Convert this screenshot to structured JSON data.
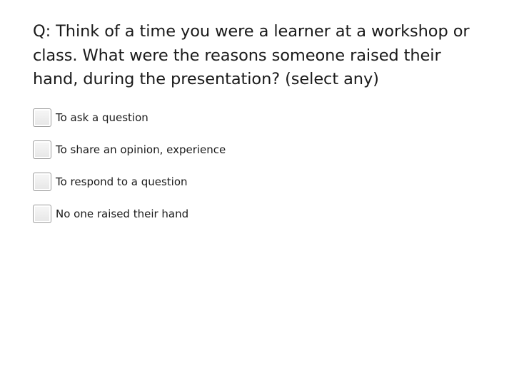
{
  "question": {
    "text": "Q: Think of a time you were a learner at a workshop or class. What were the reasons someone raised their hand, during the presentation? (select any)"
  },
  "options": [
    {
      "label": "To ask a question",
      "checked": false
    },
    {
      "label": "To share an opinion, experience",
      "checked": false
    },
    {
      "label": "To respond to a question",
      "checked": false
    },
    {
      "label": "No one raised their hand",
      "checked": false
    }
  ],
  "colors": {
    "text": "#1a1a1a",
    "checkbox_border": "#9c9c9c",
    "checkbox_fill": "#eeeeee",
    "background": "#ffffff"
  }
}
